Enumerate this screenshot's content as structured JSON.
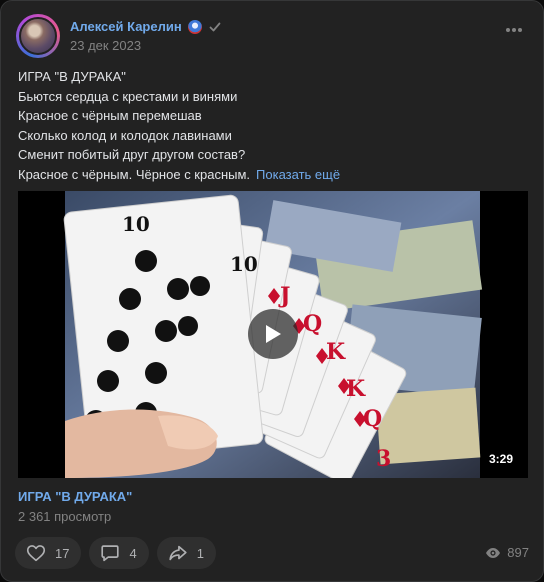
{
  "post": {
    "author": "Алексей Карелин",
    "date": "23 дек 2023",
    "text_lines": [
      "ИГРА \"В ДУРАКА\"",
      "Бьются сердца с крестами и винями",
      "Красное с чёрным перемешав",
      "Сколько колод и колодок лавинами",
      "Сменит побитый друг другом состав?",
      "Красное с чёрным. Чёрное с красным."
    ],
    "show_more": "Показать ещё"
  },
  "video": {
    "duration": "3:29",
    "title": "ИГРА \"В ДУРАКА\"",
    "views": "2 361 просмотр"
  },
  "actions": {
    "likes": "17",
    "comments": "4",
    "shares": "1",
    "views": "897"
  },
  "colors": {
    "link": "#71aaeb",
    "background": "#222222",
    "muted": "#828282"
  }
}
